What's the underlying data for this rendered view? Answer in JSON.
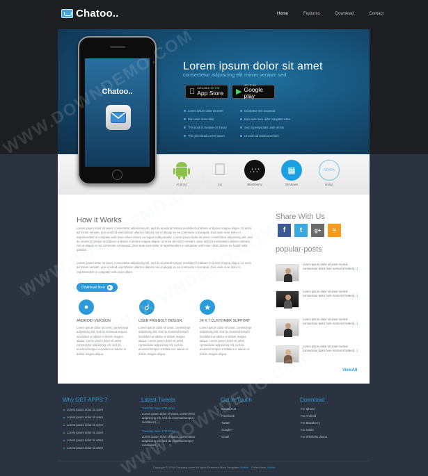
{
  "header": {
    "logo_text": "Chatoo..",
    "nav": [
      "Home",
      "Features",
      "Download",
      "Contact"
    ]
  },
  "hero": {
    "title": "Lorem ipsum dolor sit amet",
    "subtitle": "consectetur adipiscing elit minim veniam sed",
    "app_store": {
      "small": "AVAILABLE ON THE",
      "big": "App Store"
    },
    "google_play": {
      "small": "GET IT ON",
      "big": "Google play"
    },
    "features_left": [
      "Lorem ipsum dolor sit amet",
      "Duis aute irure dolor",
      "This book is treatise on theory",
      "The generated Lorem Ipsum"
    ],
    "features_right": [
      "Excepteur sint occaecat",
      "Duis aute irure dolor voluptate esse",
      "Sed ut perspiciatis unde omnis",
      "Ut enim ad minima veniam"
    ],
    "phone_app_name": "Chatoo.."
  },
  "platforms": [
    "Android",
    "Ios",
    "Blackberry",
    "Windows",
    "Nokia"
  ],
  "how_it_works": {
    "heading": "How it Works",
    "para1": "Lorem ipsum dolor sit amet, consectetur adipisicing elit, sed do eiusmod tempor incididunt ut labore et dolore magna aliqua. Ut enim ad minim veniam, quis nostrud exercitation ullamco laboris nisi ut aliquip ex ea commodo consequat. Duis aute irure dolor in reprehenderit in voluptate velit esse cillum dolore eu fugiat nulla pariatur. Lorem ipsum dolor sit amet, consectetur adipisicing elit, sed do eiusmod tempor incididunt ut labore et dolore magna aliqua. Ut enim ad minim veniam, quis nostrud exercitation ullamco laboris nisi ut aliquip ex ea commodo consequat. Duis aute irure dolor in reprehenderit in voluptate velit esse cillum dolore eu fugiat nulla pariatur.",
    "para2": "Lorem ipsum dolor sit amet, consectetur adipisicing elit, sed do eiusmod tempor incididunt ut labore et dolore magna aliqua. Ut enim ad minim veniam, quis nostrud exercitation ullamco laboris nisi ut aliquip ex ea commodo consequat. Duis aute irure dolor in reprehenderit in voluptate velit esse cillum.",
    "download_button": "Download Now"
  },
  "features": [
    {
      "title": "ANDROID VERSION",
      "text": "Lorem ipsum dolor sit amet, consectetur adipisicing elit, sed do eiusmod tempor incididunt ut labore et dolore magna aliqua. Lorem ipsum dolor sit amet, consectetur adipisicing elit, sed do eiusmod tempor incididunt ut labore et dolore magna aliqua."
    },
    {
      "title": "USER FRIENDLY DESIGN",
      "text": "Lorem ipsum dolor sit amet, consectetur adipisicing elit, sed do eiusmod tempor incididunt ut labore et dolore magna aliqua. Lorem ipsum dolor sit amet, consectetur adipisicing elit, sed do eiusmod tempor incididunt ut labore et dolore magna aliqua."
    },
    {
      "title": "24 X 7 CUSTOMER SUPPORT",
      "text": "Lorem ipsum dolor sit amet, consectetur adipisicing elit, sed do eiusmod tempor incididunt ut labore et dolore magna aliqua. Lorem ipsum dolor sit amet, consectetur adipisicing elit, sed do eiusmod tempor incididunt ut labore et dolore magna aliqua."
    }
  ],
  "sidebar": {
    "share_heading": "Share With Us",
    "popular_heading": "popular-posts",
    "posts": [
      {
        "text": "Lorem ipsum dolor sit amet normal consectetur dolor here normal of letters",
        "more": "[...]"
      },
      {
        "text": "Lorem ipsum dolor sit amet normal consectetur dolor here normal of letters",
        "more": "[...]"
      },
      {
        "text": "Lorem ipsum dolor sit amet normal consectetur dolor here normal of letters",
        "more": "[...]"
      },
      {
        "text": "Lorem ipsum dolor sit amet normal consectetur dolor here normal of letters",
        "more": "[...]"
      }
    ],
    "view_all": "ViewAll"
  },
  "footer": {
    "why_heading": "Why GET APPS ?",
    "why_items": [
      "Lorem ipsum dolor sit amet",
      "Lorem ipsum dolor sit amet",
      "Lorem ipsum dolor sit amet",
      "Lorem ipsum dolor sit amet",
      "Lorem ipsum dolor sit amet",
      "Lorem ipsum dolor sit amet"
    ],
    "tweets_heading": "Latest Tweets",
    "tweets": [
      {
        "date": "Tuesday June 17th 2014",
        "text": "Lorem ipsum dolor sit amet, consectetur adipisicing elit, sed do eiusmod tempor incididunt [...]"
      },
      {
        "date": "Tuesday June 17th 2014",
        "text": "Lorem ipsum dolor sit amet, consectetur adipisicing elit, sed do eiusmod tempor incididunt [...]"
      }
    ],
    "touch_heading": "Get in Touch",
    "touch_items": [
      "Contact Us",
      "Facebook",
      "Twitter",
      "Google+",
      "Gmail"
    ],
    "download_heading": "Download",
    "download_items": [
      "For Iphone",
      "For Android",
      "For Blackberry",
      "For Nokia",
      "For Windows phone"
    ],
    "copyright": "Copyright © 2014 Company name All rights Reserved More Templates",
    "copyright_link1": "Mobile",
    "copyright_mid": "- Collect from",
    "copyright_link2": "Mobile"
  },
  "watermark": "WWW.DOWNDEMO.COM",
  "colors": {
    "accent": "#2a9ad8",
    "hero": "#164f75",
    "dark_bg": "#2a3440"
  }
}
